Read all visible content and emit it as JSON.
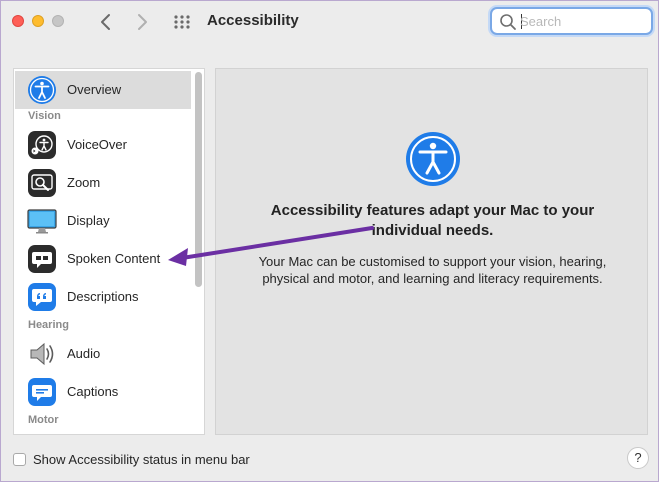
{
  "window": {
    "title": "Accessibility",
    "traffic_lights": [
      "close",
      "minimize",
      "zoom-disabled"
    ]
  },
  "toolbar": {
    "search_placeholder": "Search",
    "icons": [
      "back-arrow-icon",
      "forward-arrow-icon",
      "grid-icon",
      "search-icon"
    ]
  },
  "sidebar": {
    "items": [
      {
        "label": "Overview",
        "icon": "accessibility-icon",
        "selected": true
      },
      {
        "label": "Vision",
        "type": "group"
      },
      {
        "label": "VoiceOver",
        "icon": "voiceover-icon"
      },
      {
        "label": "Zoom",
        "icon": "zoom-icon"
      },
      {
        "label": "Display",
        "icon": "display-icon"
      },
      {
        "label": "Spoken Content",
        "icon": "speech-bubble-icon"
      },
      {
        "label": "Descriptions",
        "icon": "quote-bubble-icon"
      },
      {
        "label": "Hearing",
        "type": "group"
      },
      {
        "label": "Audio",
        "icon": "speaker-icon"
      },
      {
        "label": "Captions",
        "icon": "captions-icon"
      },
      {
        "label": "Motor",
        "type": "group"
      }
    ]
  },
  "main": {
    "heading": "Accessibility features adapt your Mac to your individual needs.",
    "description": "Your Mac can be customised to support your vision, hearing, physical and motor, and learning and literacy requirements."
  },
  "footer": {
    "checkbox_label": "Show Accessibility status in menu bar",
    "checkbox_checked": false,
    "help_label": "?"
  },
  "annotation": {
    "arrow_color": "#6b2fa3",
    "points_to": "Spoken Content"
  },
  "colors": {
    "accent": "#1f7ce8",
    "selection": "#dcdcdc",
    "window_bg": "#ececec"
  }
}
